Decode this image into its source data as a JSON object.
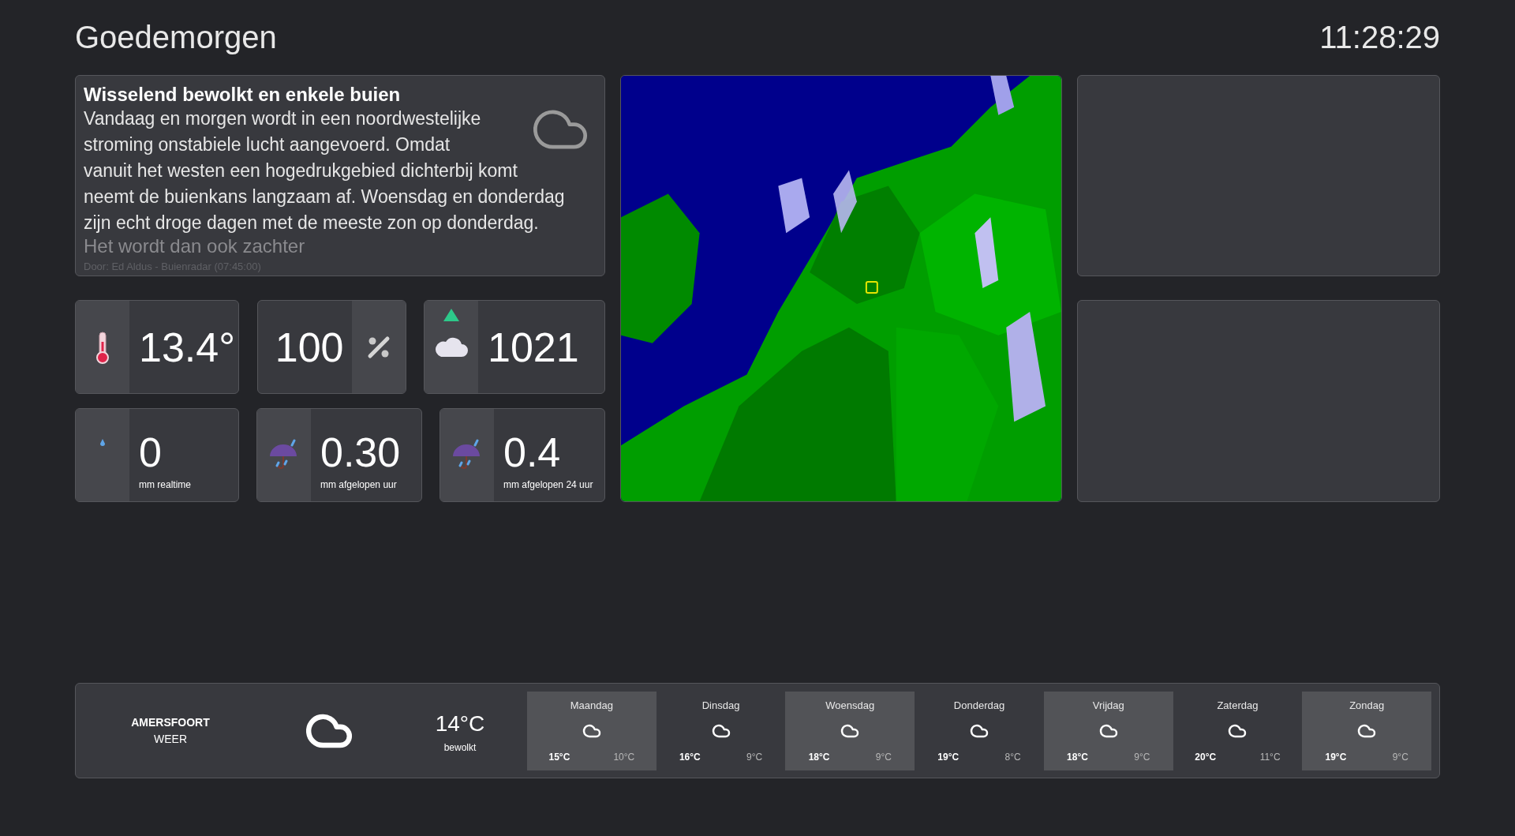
{
  "header": {
    "greeting": "Goedemorgen",
    "clock": "11:28:29"
  },
  "forecast_text": {
    "title": "Wisselend bewolkt en enkele buien",
    "lines": [
      "Vandaag en morgen wordt in een noordwestelijke",
      "stroming onstabiele lucht aangevoerd. Omdat",
      "vanuit het westen een hogedrukgebied dichterbij komt",
      "neemt de buienkans langzaam af. Woensdag en donderdag",
      "zijn echt droge dagen met de meeste zon op donderdag."
    ],
    "cut_line": "Het wordt dan ook zachter",
    "byline": "Door: Ed Aldus - Buienradar (07:45:00)"
  },
  "tiles_top": [
    {
      "kind": "icon_left",
      "value": "13.4°"
    },
    {
      "kind": "icon_right",
      "value": "100"
    },
    {
      "kind": "icon_left",
      "value": "1021",
      "rising": true
    }
  ],
  "tiles_bottom": [
    {
      "value": "0",
      "unit": "mm realtime"
    },
    {
      "value": "0.30",
      "unit": "mm afgelopen uur"
    },
    {
      "value": "0.4",
      "unit": "mm afgelopen 24 uur"
    }
  ],
  "current": {
    "city": "AMERSFOORT",
    "subtitle": "WEER",
    "temperature": "14°C",
    "condition": "bewolkt"
  },
  "days": [
    {
      "day": "Maandag",
      "high": "15°C",
      "low": "10°C"
    },
    {
      "day": "Dinsdag",
      "high": "16°C",
      "low": "9°C"
    },
    {
      "day": "Woensdag",
      "high": "18°C",
      "low": "9°C"
    },
    {
      "day": "Donderdag",
      "high": "19°C",
      "low": "8°C"
    },
    {
      "day": "Vrijdag",
      "high": "18°C",
      "low": "9°C"
    },
    {
      "day": "Zaterdag",
      "high": "20°C",
      "low": "11°C"
    },
    {
      "day": "Zondag",
      "high": "19°C",
      "low": "9°C"
    }
  ]
}
